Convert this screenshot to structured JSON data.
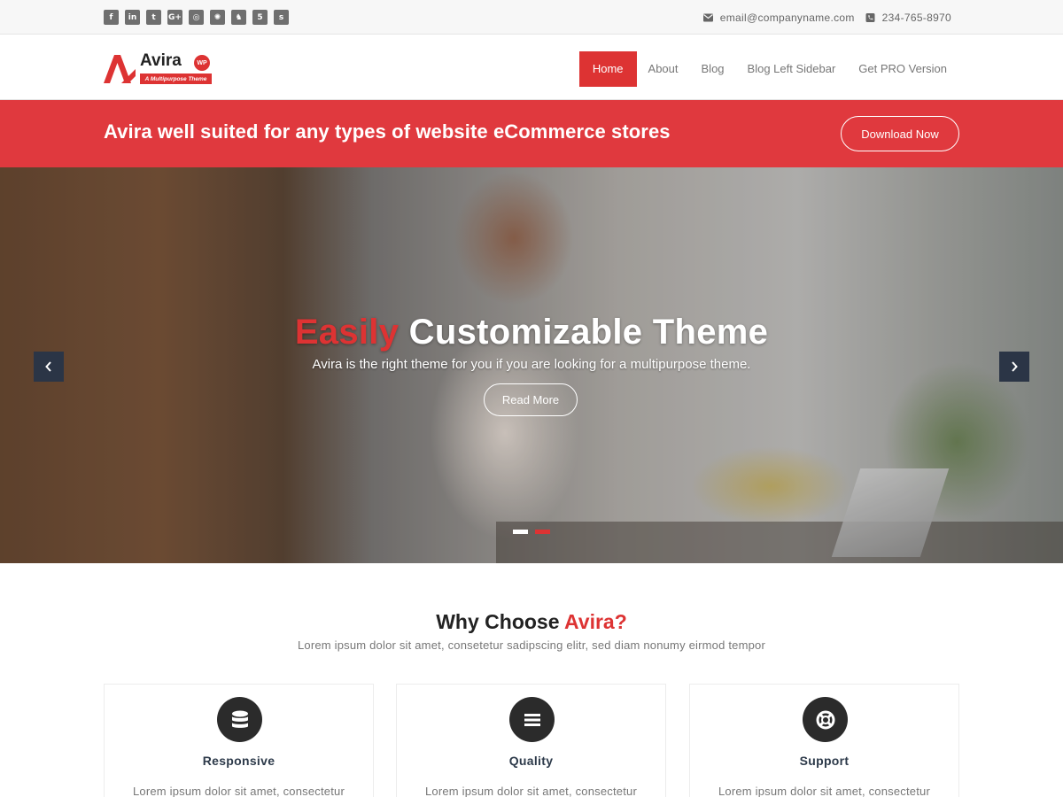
{
  "topbar": {
    "social": [
      {
        "icon": "facebook-icon",
        "glyph": "f"
      },
      {
        "icon": "linkedin-icon",
        "glyph": "in"
      },
      {
        "icon": "twitter-icon",
        "glyph": "t"
      },
      {
        "icon": "google-plus-icon",
        "glyph": "G+"
      },
      {
        "icon": "instagram-icon",
        "glyph": "◎"
      },
      {
        "icon": "dribbble-icon",
        "glyph": "✺"
      },
      {
        "icon": "github-icon",
        "glyph": "♞"
      },
      {
        "icon": "html5-icon",
        "glyph": "5"
      },
      {
        "icon": "skype-icon",
        "glyph": "s"
      }
    ],
    "email": "email@companyname.com",
    "phone": "234-765-8970"
  },
  "header": {
    "logo_name": "Avira",
    "logo_badge": "WP",
    "logo_tagline": "A Multipurpose Theme",
    "nav": [
      {
        "label": "Home",
        "active": true
      },
      {
        "label": "About",
        "active": false
      },
      {
        "label": "Blog",
        "active": false
      },
      {
        "label": "Blog Left Sidebar",
        "active": false
      },
      {
        "label": "Get PRO Version",
        "active": false
      }
    ]
  },
  "banner": {
    "text": "Avira well suited for any types of website eCommerce stores",
    "button": "Download Now"
  },
  "hero": {
    "title_accent": "Easily",
    "title_rest": " Customizable Theme",
    "subtitle": "Avira is the right theme for you if you are looking for a multipurpose theme.",
    "button": "Read More",
    "slides_total": 2,
    "active_slide": 2
  },
  "features": {
    "title_plain": "Why Choose ",
    "title_accent": "Avira?",
    "subtitle": "Lorem ipsum dolor sit amet, consetetur sadipscing elitr, sed diam nonumy eirmod tempor",
    "cards": [
      {
        "icon": "database-icon",
        "title": "Responsive",
        "text": "Lorem ipsum dolor sit amet, consectetur"
      },
      {
        "icon": "list-icon",
        "title": "Quality",
        "text": "Lorem ipsum dolor sit amet, consectetur"
      },
      {
        "icon": "life-ring-icon",
        "title": "Support",
        "text": "Lorem ipsum dolor sit amet, consectetur"
      }
    ]
  },
  "colors": {
    "accent": "#dd3333",
    "banner": "#e0393e",
    "dark": "#2b2b2b"
  }
}
